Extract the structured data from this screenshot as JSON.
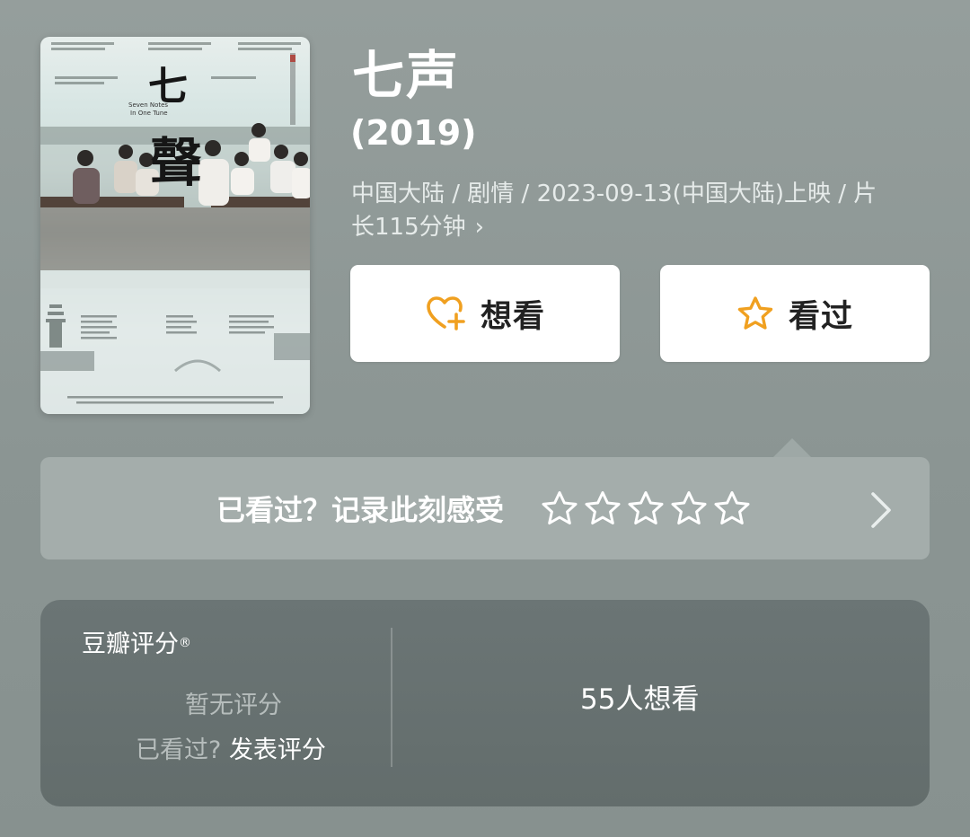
{
  "movie": {
    "title": "七声",
    "year": "(2019)",
    "meta_line1": "中国大陆 / 剧情 / 2023-09-13(中国大陆)上映 / 片",
    "meta_line2": "长115分钟",
    "chevron": "›",
    "poster": {
      "title_glyph_1": "七",
      "title_glyph_2": "聲",
      "english_title_1": "Seven Notes",
      "english_title_2": "In One Tune"
    }
  },
  "actions": {
    "want_label": "想看",
    "want_icon": "heart-plus-icon",
    "seen_label": "看过",
    "seen_icon": "star-outline-icon",
    "accent_color": "#f0a020"
  },
  "rate_prompt": {
    "text": "已看过？记录此刻感受",
    "stars_total": 5,
    "stars_filled": 0,
    "chevron": "›"
  },
  "douban_score": {
    "title": "豆瓣评分",
    "registered_mark": "®",
    "no_score": "暂无评分",
    "seen_question": "已看过?",
    "post_score": "发表评分",
    "want_count": "55人想看"
  }
}
